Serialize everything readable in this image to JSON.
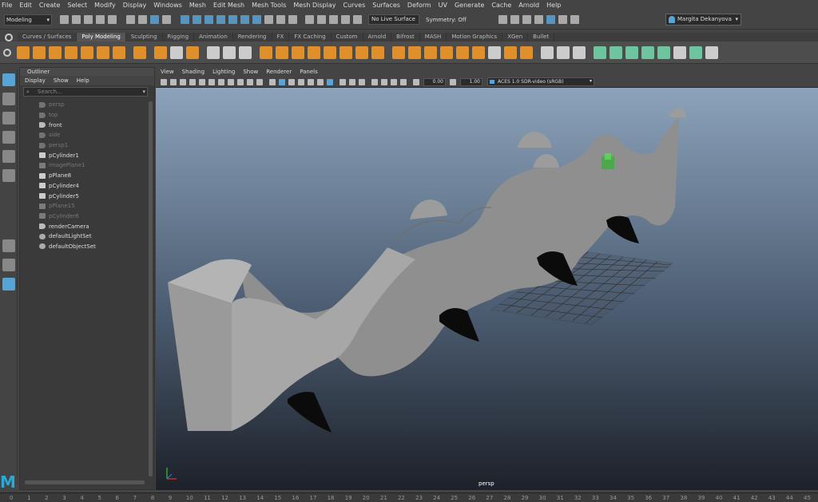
{
  "menubar": [
    "File",
    "Edit",
    "Create",
    "Select",
    "Modify",
    "Display",
    "Windows",
    "Mesh",
    "Edit Mesh",
    "Mesh Tools",
    "Mesh Display",
    "Curves",
    "Surfaces",
    "Deform",
    "UV",
    "Generate",
    "Cache",
    "Arnold",
    "Help"
  ],
  "status": {
    "mode": "Modeling",
    "live_surface": "No Live Surface",
    "symmetry": "Symmetry: Off",
    "user": "Margita Dekanyova"
  },
  "shelf_tabs": [
    "Curves / Surfaces",
    "Poly Modeling",
    "Sculpting",
    "Rigging",
    "Animation",
    "Rendering",
    "FX",
    "FX Caching",
    "Custom",
    "Arnold",
    "Bifrost",
    "MASH",
    "Motion Graphics",
    "XGen",
    "Bullet"
  ],
  "shelf_active": "Poly Modeling",
  "outliner": {
    "title": "Outliner",
    "menu": [
      "Display",
      "Show",
      "Help"
    ],
    "search_placeholder": "Search...",
    "items": [
      {
        "label": "persp",
        "dim": true,
        "icon": "camera-icon"
      },
      {
        "label": "top",
        "dim": true,
        "icon": "camera-icon"
      },
      {
        "label": "front",
        "dim": false,
        "icon": "camera-icon"
      },
      {
        "label": "side",
        "dim": true,
        "icon": "camera-icon"
      },
      {
        "label": "persp1",
        "dim": true,
        "icon": "camera-icon"
      },
      {
        "label": "pCylinder1",
        "dim": false,
        "icon": "mesh-icon"
      },
      {
        "label": "imagePlane1",
        "dim": true,
        "icon": "image-plane-icon"
      },
      {
        "label": "pPlane8",
        "dim": false,
        "icon": "mesh-icon"
      },
      {
        "label": "pCylinder4",
        "dim": false,
        "icon": "mesh-icon"
      },
      {
        "label": "pCylinder5",
        "dim": false,
        "icon": "mesh-icon"
      },
      {
        "label": "pPlane15",
        "dim": true,
        "icon": "mesh-icon"
      },
      {
        "label": "pCylinder6",
        "dim": true,
        "icon": "mesh-icon"
      },
      {
        "label": "renderCamera",
        "dim": false,
        "icon": "camera-icon"
      },
      {
        "label": "defaultLightSet",
        "dim": false,
        "icon": "set-icon"
      },
      {
        "label": "defaultObjectSet",
        "dim": false,
        "icon": "set-icon"
      }
    ]
  },
  "viewport": {
    "menu": [
      "View",
      "Shading",
      "Lighting",
      "Show",
      "Renderer",
      "Panels"
    ],
    "exposure": "0.00",
    "gamma": "1.00",
    "color_space": "ACES 1.0 SDR-video (sRGB)",
    "camera_label": "persp"
  },
  "timeline": [
    "0",
    "1",
    "2",
    "3",
    "4",
    "5",
    "6",
    "7",
    "8",
    "9",
    "10",
    "11",
    "12",
    "13",
    "14",
    "15",
    "16",
    "17",
    "18",
    "19",
    "20",
    "21",
    "22",
    "23",
    "24",
    "25",
    "26",
    "27",
    "28",
    "29",
    "30",
    "31",
    "32",
    "33",
    "34",
    "35",
    "36",
    "37",
    "38",
    "39",
    "40",
    "41",
    "42",
    "43",
    "44",
    "45"
  ],
  "colors": {
    "accent": "#5aa3d6",
    "shelf_orange": "#e0902a",
    "shelf_green": "#6fc4a0"
  }
}
